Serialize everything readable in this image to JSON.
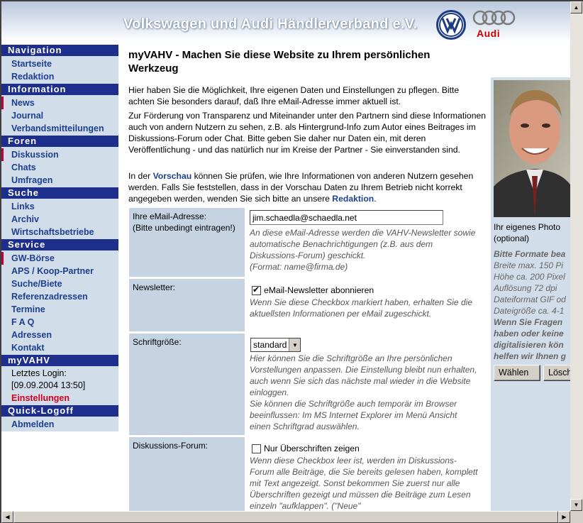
{
  "header": {
    "title": "Volkswagen und Audi Händlerverband e.V.",
    "audi_text": "Audi"
  },
  "sidebar": {
    "sections": [
      {
        "heading": "Navigation",
        "items": [
          {
            "label": "Startseite",
            "state": "normal"
          },
          {
            "label": "Redaktion",
            "state": "normal"
          }
        ]
      },
      {
        "heading": "Information",
        "items": [
          {
            "label": "News",
            "state": "active"
          },
          {
            "label": "Journal",
            "state": "normal"
          },
          {
            "label": "Verbandsmitteilungen",
            "state": "normal"
          }
        ]
      },
      {
        "heading": "Foren",
        "items": [
          {
            "label": "Diskussion",
            "state": "active"
          },
          {
            "label": "Chats",
            "state": "normal"
          },
          {
            "label": "Umfragen",
            "state": "normal"
          }
        ]
      },
      {
        "heading": "Suche",
        "items": [
          {
            "label": "Links",
            "state": "normal"
          },
          {
            "label": "Archiv",
            "state": "normal"
          },
          {
            "label": "Wirtschaftsbetriebe",
            "state": "normal"
          }
        ]
      },
      {
        "heading": "Service",
        "items": [
          {
            "label": "GW-Börse",
            "state": "active"
          },
          {
            "label": "APS / Koop-Partner",
            "state": "normal"
          },
          {
            "label": "Suche/Biete",
            "state": "normal"
          },
          {
            "label": "Referenzadressen",
            "state": "normal"
          },
          {
            "label": "Termine",
            "state": "normal"
          },
          {
            "label": "F A Q",
            "state": "normal"
          },
          {
            "label": "Adressen",
            "state": "normal"
          },
          {
            "label": "Kontakt",
            "state": "normal"
          }
        ]
      }
    ],
    "myvahv": {
      "heading": "myVAHV",
      "last_login_label": "Letztes Login:",
      "last_login_value": "[09.09.2004 13:50]",
      "settings_label": "Einstellungen"
    },
    "logoff": {
      "heading": "Quick-Logoff",
      "item": "Abmelden"
    }
  },
  "main": {
    "title": "myVAHV - Machen Sie diese Website zu Ihrem persönlichen Werkzeug",
    "para1": "Hier haben Sie die Möglichkeit, Ihre eigenen Daten und Einstellungen zu pflegen. Bitte achten Sie besonders darauf, daß Ihre eMail-Adresse immer aktuell ist.",
    "para2": "Zur Förderung von Transparenz und Miteinander unter den Partnern sind diese Informationen auch von andern Nutzern zu sehen, z.B. als Hintergrund-Info zum Autor eines Beitrages im Diskussions-Forum oder Chat. Bitte geben Sie daher nur Daten ein, mit deren Veröffentlichung - und das natürlich nur im Kreise der Partner - Sie einverstanden sind.",
    "para3_before": "In der ",
    "para3_link1": "Vorschau",
    "para3_middle": " können Sie prüfen, wie Ihre Informationen von anderen Nutzern gesehen werden. Falls Sie feststellen, dass in der Vorschau Daten zu Ihrem Betrieb nicht korrekt angegeben werden, wenden Sie sich bitte an unsere ",
    "para3_link2": "Redaktion",
    "para3_after": ".",
    "form": {
      "email": {
        "label": "Ihre eMail-Adresse:",
        "label_note": "(Bitte unbedingt eintragen!)",
        "value": "jim.schaedla@schaedla.net",
        "hint": "An diese eMail-Adresse werden die VAHV-Newsletter sowie automatische Benachrichtigungen (z.B. aus dem Diskussions-Forum) geschickt.",
        "format": "(Format: name@firma.de)"
      },
      "newsletter": {
        "label": "Newsletter:",
        "checkbox_label": "eMail-Newsletter abonnieren",
        "checked": true,
        "hint": "Wenn Sie diese Checkbox markiert haben, erhalten Sie die aktuellsten Informationen per eMail zugeschickt."
      },
      "fontsize": {
        "label": "Schriftgröße:",
        "selected": "standard",
        "hint1": "Hier können Sie die Schriftgröße an Ihre persönlichen Vorstellungen anpassen. Die Einstellung bleibt nun erhalten, auch wenn Sie sich das nächste mal wieder in die Website einloggen.",
        "hint2": "Sie können die Schriftgröße auch temporär im Browser beeinflussen: Im MS Internet Explorer im Menü Ansicht einen Schriftgrad auswählen."
      },
      "forum": {
        "label": "Diskussions-Forum:",
        "checkbox_label": "Nur Überschriften zeigen",
        "checked": false,
        "hint": "Wenn diese Checkbox leer ist, werden im Diskussions-Forum alle Beiträge, die Sie bereits gelesen haben, komplett mit Text angezeigt. Sonst bekommen Sie zuerst nur alle Überschriften gezeigt und müssen die Beiträge zum Lesen einzeln \"aufklappen\". (\"Neue\""
      }
    }
  },
  "photo_panel": {
    "caption": "Ihr eigenes Photo",
    "caption_note": "(optional)",
    "hints": [
      {
        "text": "Bitte Formate bea",
        "bold": true
      },
      {
        "text": "Breite max. 150 Pi",
        "bold": false
      },
      {
        "text": "Höhe ca. 200 Pixel",
        "bold": false
      },
      {
        "text": "Auflösung 72 dpi",
        "bold": false
      },
      {
        "text": "Dateiformat GIF od",
        "bold": false
      },
      {
        "text": "Dateigröße ca. 4-1",
        "bold": false
      },
      {
        "text": "Wenn Sie Fragen",
        "bold": true
      },
      {
        "text": "haben oder keine",
        "bold": true
      },
      {
        "text": "digitalisieren kön",
        "bold": true
      },
      {
        "text": "helfen wir Ihnen g",
        "bold": true
      }
    ],
    "choose_button": "Wählen",
    "delete_button": "Lösch"
  },
  "colors": {
    "nav_heading_bg": "#1d2e8c",
    "nav_bg": "#d1dde9",
    "link_blue": "#1e3f8f",
    "active_marker": "#c0003c",
    "highlight_red": "#d40020",
    "form_label_bg": "#c5d3e2"
  }
}
